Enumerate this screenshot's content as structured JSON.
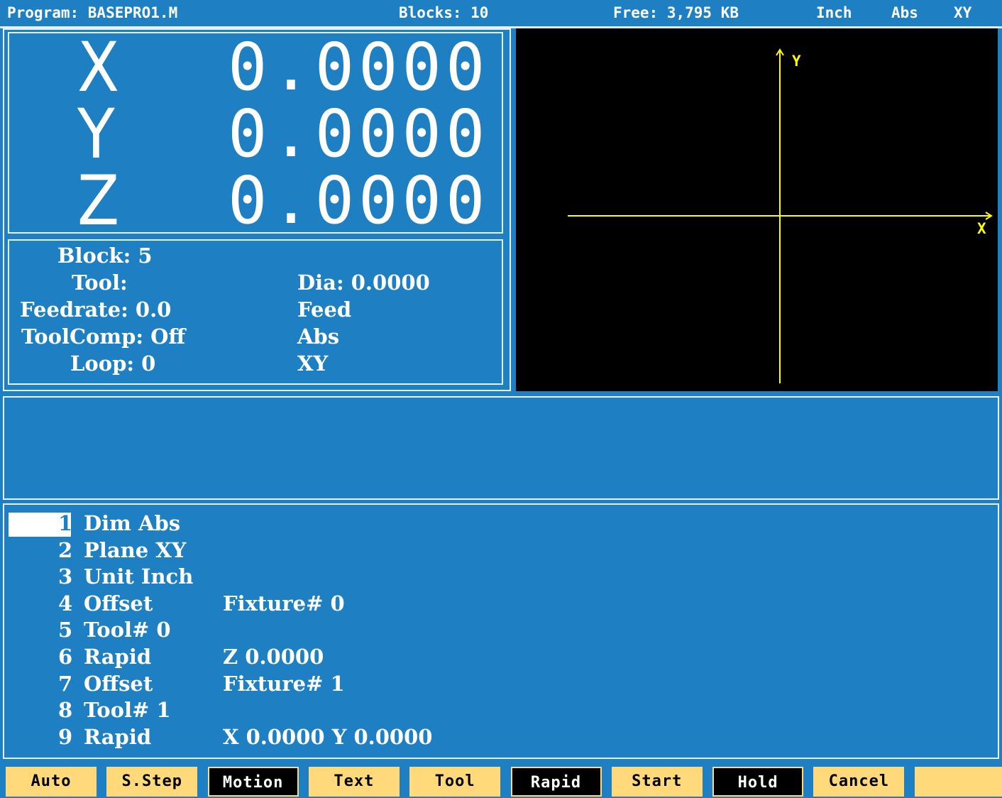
{
  "status": {
    "program": "Program: BASEPRO1.M",
    "blocks": "Blocks: 10",
    "free": "Free: 3,795 KB",
    "units": "Inch",
    "mode": "Abs",
    "plane": "XY"
  },
  "dro": [
    {
      "axis": "X",
      "value": "0.0000"
    },
    {
      "axis": "Y",
      "value": "0.0000"
    },
    {
      "axis": "Z",
      "value": "0.0000"
    }
  ],
  "info": {
    "block": "Block: 5",
    "tool": "Tool:",
    "feedrate": "Feedrate: 0.0",
    "toolcomp": "ToolComp: Off",
    "loop": "Loop: 0",
    "dia": "Dia: 0.0000",
    "feed": "Feed",
    "abs": "Abs",
    "xy": "XY"
  },
  "graph": {
    "x_label": "X",
    "y_label": "Y",
    "axis_color": "#ffff00",
    "background": "#000000"
  },
  "program_lines": [
    {
      "num": "1",
      "cmd": "Dim Abs",
      "arg": ""
    },
    {
      "num": "2",
      "cmd": "Plane XY",
      "arg": ""
    },
    {
      "num": "3",
      "cmd": "Unit Inch",
      "arg": ""
    },
    {
      "num": "4",
      "cmd": "Offset",
      "arg": "Fixture# 0"
    },
    {
      "num": "5",
      "cmd": "Tool# 0",
      "arg": ""
    },
    {
      "num": "6",
      "cmd": "Rapid",
      "arg": "Z 0.0000"
    },
    {
      "num": "7",
      "cmd": "Offset",
      "arg": "Fixture# 1"
    },
    {
      "num": "8",
      "cmd": "Tool# 1",
      "arg": ""
    },
    {
      "num": "9",
      "cmd": "Rapid",
      "arg": "X 0.0000 Y 0.0000"
    }
  ],
  "softkeys": [
    "Auto",
    "S.Step",
    "Motion",
    "Text",
    "Tool",
    "Rapid",
    "Start",
    "Hold",
    "Cancel",
    ""
  ]
}
